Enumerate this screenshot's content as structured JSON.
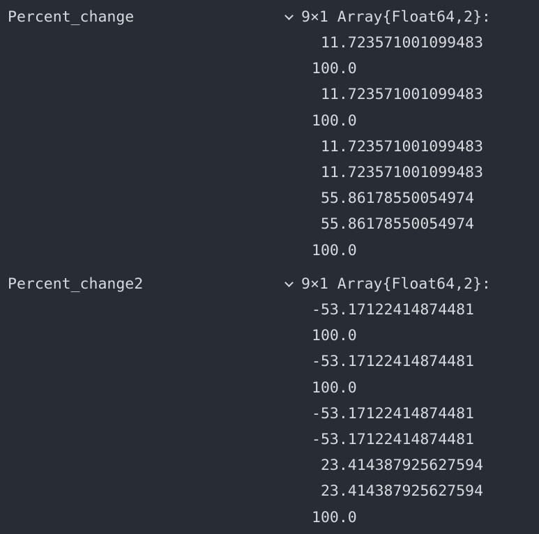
{
  "variables": [
    {
      "name": "Percent_change",
      "type_label": "9×1 Array{Float64,2}:",
      "values": [
        " 11.723571001099483",
        "100.0",
        " 11.723571001099483",
        "100.0",
        " 11.723571001099483",
        " 11.723571001099483",
        " 55.86178550054974",
        " 55.86178550054974",
        "100.0"
      ]
    },
    {
      "name": "Percent_change2",
      "type_label": "9×1 Array{Float64,2}:",
      "values": [
        "-53.17122414874481",
        "100.0",
        "-53.17122414874481",
        "100.0",
        "-53.17122414874481",
        "-53.17122414874481",
        " 23.414387925627594",
        " 23.414387925627594",
        "100.0"
      ]
    }
  ],
  "icons": {
    "expand": "chevron-down-icon"
  },
  "colors": {
    "background": "#282c34",
    "text": "#d7dae0"
  }
}
